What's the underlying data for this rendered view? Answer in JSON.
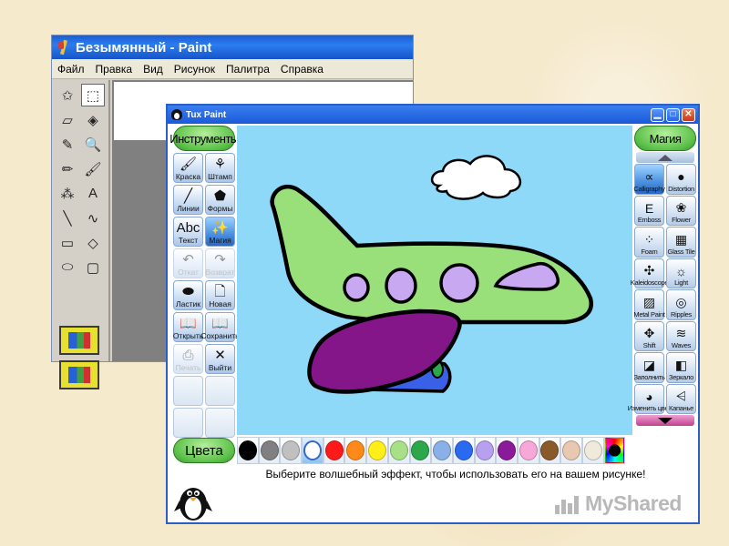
{
  "paint": {
    "title": "Безымянный - Paint",
    "menu": [
      "Файл",
      "Правка",
      "Вид",
      "Рисунок",
      "Палитра",
      "Справка"
    ],
    "tools": [
      "free-select-icon",
      "rect-select-icon",
      "eraser-icon",
      "fill-bucket-icon",
      "color-picker-icon",
      "magnifier-icon",
      "pencil-icon",
      "brush-icon",
      "airbrush-icon",
      "text-icon",
      "line-icon",
      "curve-icon",
      "rectangle-icon",
      "polygon-icon",
      "ellipse-icon",
      "rounded-rect-icon"
    ],
    "tool_glyphs": [
      "✩",
      "⬚",
      "▱",
      "◈",
      "✎",
      "🔍",
      "✏",
      "🖌",
      "⁂",
      "A",
      "╲",
      "∿",
      "▭",
      "◇",
      "⬭",
      "▢"
    ]
  },
  "tux": {
    "title": "Tux Paint",
    "tools_header": "Инструменты",
    "tools": [
      {
        "name": "tool-paint",
        "label": "Краска",
        "icon": "🖌",
        "state": "normal"
      },
      {
        "name": "tool-stamp",
        "label": "Штамп",
        "icon": "⚘",
        "state": "normal"
      },
      {
        "name": "tool-lines",
        "label": "Линии",
        "icon": "╱",
        "state": "normal"
      },
      {
        "name": "tool-shapes",
        "label": "Формы",
        "icon": "⬟",
        "state": "normal"
      },
      {
        "name": "tool-text",
        "label": "Текст",
        "icon": "Abc",
        "state": "normal"
      },
      {
        "name": "tool-magic",
        "label": "Магия",
        "icon": "✨",
        "state": "active"
      },
      {
        "name": "tool-undo",
        "label": "Откат",
        "icon": "↶",
        "state": "disabled"
      },
      {
        "name": "tool-redo",
        "label": "Возврат",
        "icon": "↷",
        "state": "disabled"
      },
      {
        "name": "tool-eraser",
        "label": "Ластик",
        "icon": "⬬",
        "state": "normal"
      },
      {
        "name": "tool-new",
        "label": "Новая",
        "icon": "🗋",
        "state": "normal"
      },
      {
        "name": "tool-open",
        "label": "Открыть",
        "icon": "📖",
        "state": "normal"
      },
      {
        "name": "tool-save",
        "label": "Сохранить",
        "icon": "📖",
        "state": "normal"
      },
      {
        "name": "tool-print",
        "label": "Печать",
        "icon": "⎙",
        "state": "disabled"
      },
      {
        "name": "tool-quit",
        "label": "Выйти",
        "icon": "✕",
        "state": "normal"
      },
      {
        "name": "tool-empty-1",
        "label": "",
        "icon": "",
        "state": "empty"
      },
      {
        "name": "tool-empty-2",
        "label": "",
        "icon": "",
        "state": "empty"
      },
      {
        "name": "tool-empty-3",
        "label": "",
        "icon": "",
        "state": "empty"
      },
      {
        "name": "tool-empty-4",
        "label": "",
        "icon": "",
        "state": "empty"
      }
    ],
    "magic_header": "Магия",
    "magic": [
      {
        "label": "Calligraphy",
        "icon": "∝",
        "state": "active"
      },
      {
        "label": "Distortion",
        "icon": "●",
        "state": "normal"
      },
      {
        "label": "Emboss",
        "icon": "E",
        "state": "normal"
      },
      {
        "label": "Flower",
        "icon": "❀",
        "state": "normal"
      },
      {
        "label": "Foam",
        "icon": "⁘",
        "state": "normal"
      },
      {
        "label": "Glass Tile",
        "icon": "▦",
        "state": "normal"
      },
      {
        "label": "Kaleidoscope",
        "icon": "✣",
        "state": "normal"
      },
      {
        "label": "Light",
        "icon": "☼",
        "state": "normal"
      },
      {
        "label": "Metal Paint",
        "icon": "▨",
        "state": "normal"
      },
      {
        "label": "Ripples",
        "icon": "◎",
        "state": "normal"
      },
      {
        "label": "Shift",
        "icon": "✥",
        "state": "normal"
      },
      {
        "label": "Waves",
        "icon": "≋",
        "state": "normal"
      },
      {
        "label": "Заполнить",
        "icon": "◪",
        "state": "normal"
      },
      {
        "label": "Зеркало",
        "icon": "◧",
        "state": "normal"
      },
      {
        "label": "Изменить цвет",
        "icon": "◕",
        "state": "normal"
      },
      {
        "label": "Капанье",
        "icon": "⩤",
        "state": "normal"
      }
    ],
    "colors_header": "Цвета",
    "colors": [
      "#000000",
      "#808080",
      "#c0c0c0",
      "#ffffff",
      "#ff1a1a",
      "#ff8a1a",
      "#ffee1a",
      "#a8e088",
      "#2ca84a",
      "#8ab0e8",
      "#2a6af0",
      "#b8a0f0",
      "#8a1a9a",
      "#f8a8d8",
      "#8a5a2a",
      "#e8c8b0",
      "#f0eadc",
      "rainbow"
    ],
    "selected_color_index": 3,
    "status": "Выберите волшебный эффект, чтобы использовать его на вашем рисунке!",
    "watermark": "MyShared"
  }
}
